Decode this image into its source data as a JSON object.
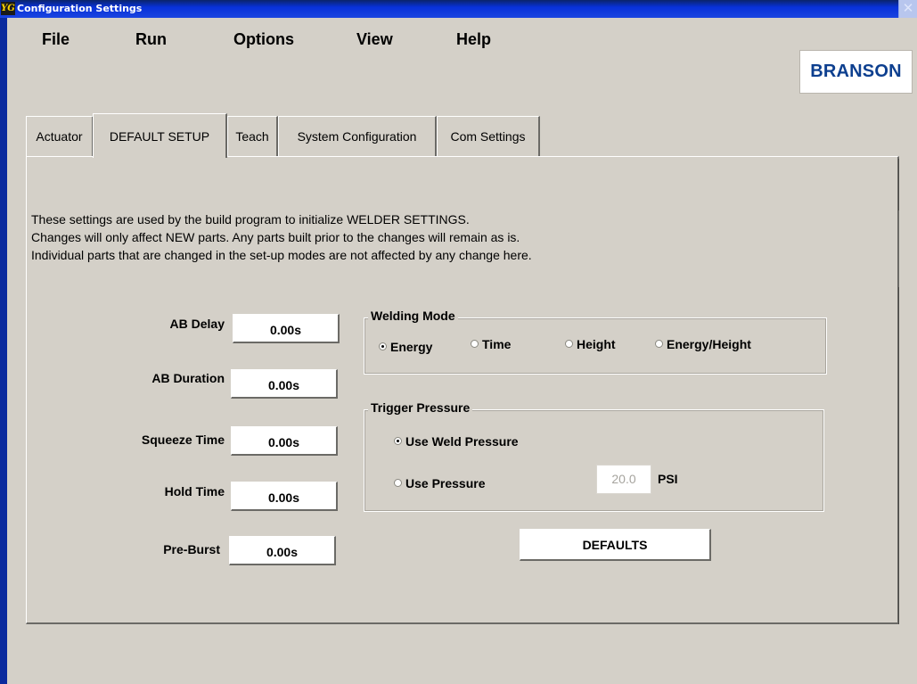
{
  "window": {
    "title": "Configuration Settings",
    "icon_text": "YG",
    "close_label": "✕"
  },
  "menu": {
    "items": [
      "File",
      "Run",
      "Options",
      "View",
      "Help"
    ]
  },
  "logo": {
    "text": "BRANSON"
  },
  "tabs": [
    "Actuator",
    "DEFAULT SETUP",
    "Teach",
    "System Configuration",
    "Com Settings"
  ],
  "active_tab": "DEFAULT SETUP",
  "info": [
    "These settings are used by the build program to initialize WELDER SETTINGS.",
    "Changes will only affect NEW parts. Any parts built prior to the changes will remain as is.",
    "Individual parts that are changed in the set-up modes are not affected by any change here."
  ],
  "fields": [
    {
      "label": "AB Delay",
      "value": "0.00s"
    },
    {
      "label": "AB Duration",
      "value": "0.00s"
    },
    {
      "label": "Squeeze Time",
      "value": "0.00s"
    },
    {
      "label": "Hold Time",
      "value": "0.00s"
    },
    {
      "label": "Pre-Burst",
      "value": "0.00s"
    }
  ],
  "welding_mode": {
    "title": "Welding Mode",
    "options": [
      "Energy",
      "Time",
      "Height",
      "Energy/Height"
    ],
    "selected": "Energy"
  },
  "trigger_pressure": {
    "title": "Trigger Pressure",
    "options": [
      "Use Weld Pressure",
      "Use Pressure"
    ],
    "selected": "Use Weld Pressure",
    "pressure_value": "20.0",
    "pressure_unit": "PSI"
  },
  "buttons": {
    "defaults": "DEFAULTS"
  }
}
